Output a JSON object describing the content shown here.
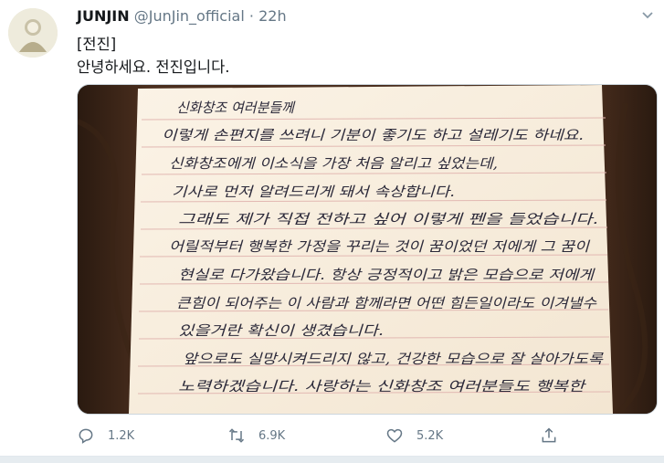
{
  "tweet": {
    "display_name": "JUNJIN",
    "handle": "@JunJin_official",
    "separator": "·",
    "time": "22h",
    "text_line1": "[전진]",
    "text_line2": "안녕하세요. 전진입니다.",
    "letter_lines": [
      "신화창조 여러분들께",
      "이렇게 손편지를 쓰려니 기분이 좋기도 하고 설레기도 하네요.",
      "신화창조에게 이소식을 가장 처음 알리고 싶었는데,",
      "기사로 먼저 알려드리게 돼서 속상합니다.",
      "그래도 제가 직접 전하고 싶어 이렇게 펜을 들었습니다.",
      "어릴적부터 행복한 가정을 꾸리는 것이 꿈이었던 저에게 그 꿈이",
      "현실로 다가왔습니다. 항상 긍정적이고 밝은 모습으로 저에게",
      "큰힘이 되어주는 이 사람과 함께라면 어떤 힘든일이라도 이겨낼수",
      "있을거란 확신이 생겼습니다.",
      "앞으로도 실망시켜드리지 않고, 건강한 모습으로 잘 살아가도록",
      "노력하겠습니다. 사랑하는 신화창조 여러분들도 행복한"
    ],
    "actions": {
      "reply_count": "1.2K",
      "retweet_count": "6.9K",
      "like_count": "5.2K"
    }
  },
  "icons": [
    "avatar",
    "chevron-down-icon",
    "reply-icon",
    "retweet-icon",
    "heart-icon",
    "share-icon"
  ]
}
